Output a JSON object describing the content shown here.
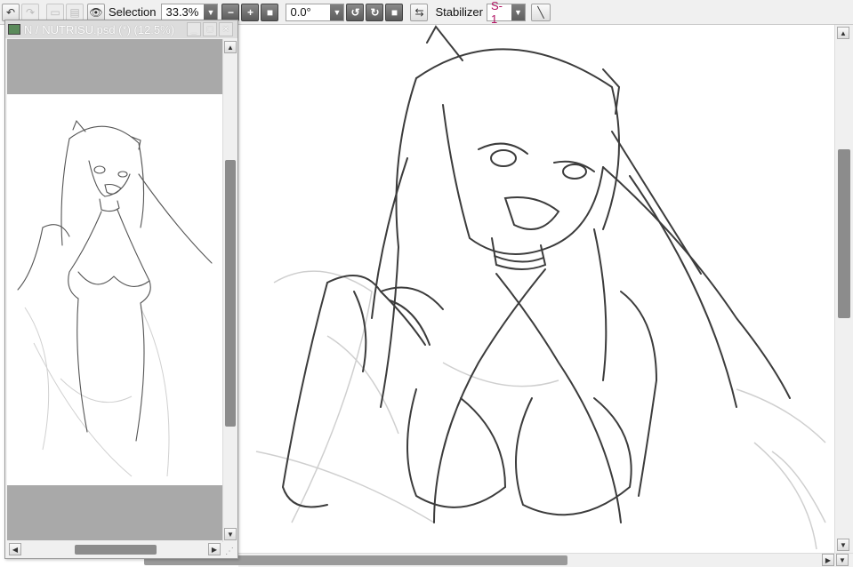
{
  "toolbar": {
    "selection_label": "Selection",
    "zoom_value": "33.3%",
    "rotation_value": "0.0°",
    "stabilizer_label": "Stabilizer",
    "stabilizer_value": "S-1",
    "colors": {
      "stabilizer_text": "#b01060"
    },
    "icons": [
      "undo-icon",
      "redo-icon",
      "eye-icon",
      "zoom-out-icon",
      "zoom-in-icon",
      "zoom-reset-icon",
      "rotate-left-icon",
      "rotate-right-icon",
      "rotate-reset-icon",
      "flip-horizontal-icon",
      "pen-icon"
    ]
  },
  "navigator": {
    "title": "N / NUTRISU.psd (*) (12.5%)"
  }
}
